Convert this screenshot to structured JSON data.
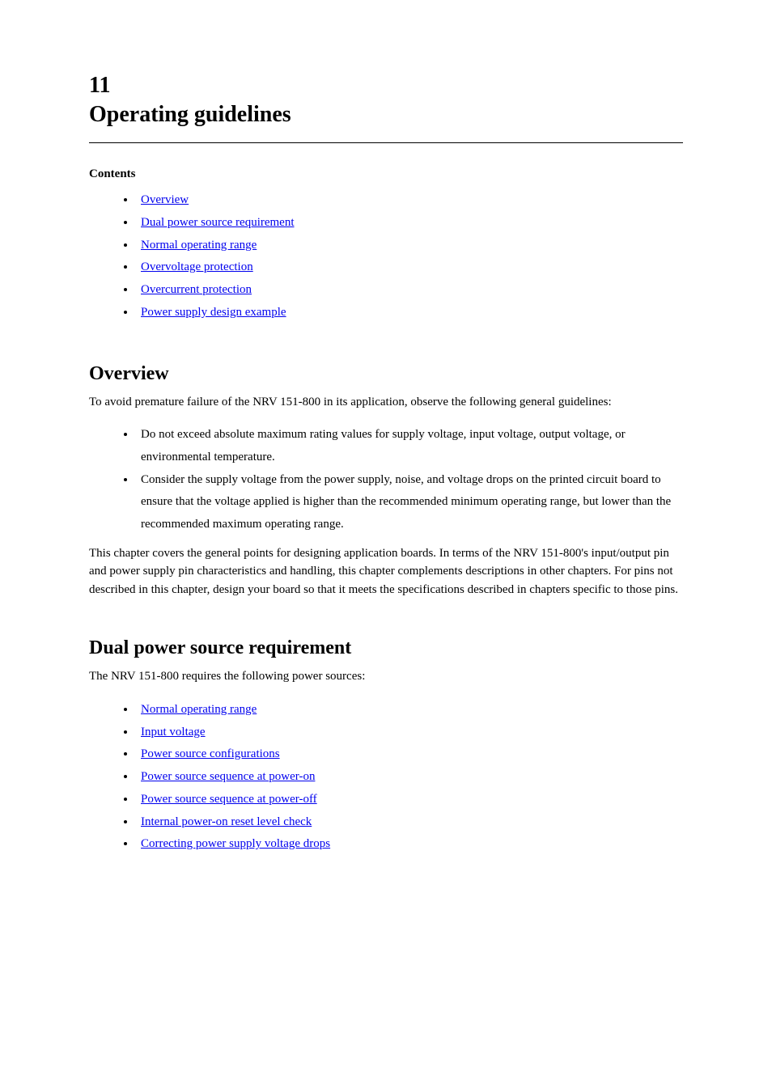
{
  "section": {
    "number": "11",
    "title": "Operating guidelines"
  },
  "contents_label": "Contents",
  "contents": [
    "Overview",
    "Dual power source requirement",
    "Normal operating range",
    "Overvoltage protection",
    "Overcurrent protection",
    "Power supply design example"
  ],
  "overview": {
    "heading": "Overview",
    "p1": "To avoid premature failure of the NRV 151-800 in its application, observe the following general guidelines:",
    "bullets": [
      "Do not exceed absolute maximum rating values for supply voltage, input voltage, output voltage, or environmental temperature.",
      "Consider the supply voltage from the power supply, noise, and voltage drops on the printed circuit board to ensure that the voltage applied is higher than the recommended minimum operating range, but lower than the recommended maximum operating range."
    ],
    "p2": "This chapter covers the general points for designing application boards. In terms of the NRV 151-800's input/output pin and power supply pin characteristics and handling, this chapter complements descriptions in other chapters. For pins not described in this chapter, design your board so that it meets the specifications described in chapters specific to those pins."
  },
  "dual_power": {
    "heading": "Dual power source requirement",
    "p1": "The NRV 151-800 requires the following power sources:",
    "links": [
      "Normal operating range",
      "Input voltage",
      "Power source configurations",
      "Power source sequence at power-on",
      "Power source sequence at power-off",
      "Internal power-on reset level check",
      "Correcting power supply voltage drops"
    ]
  }
}
